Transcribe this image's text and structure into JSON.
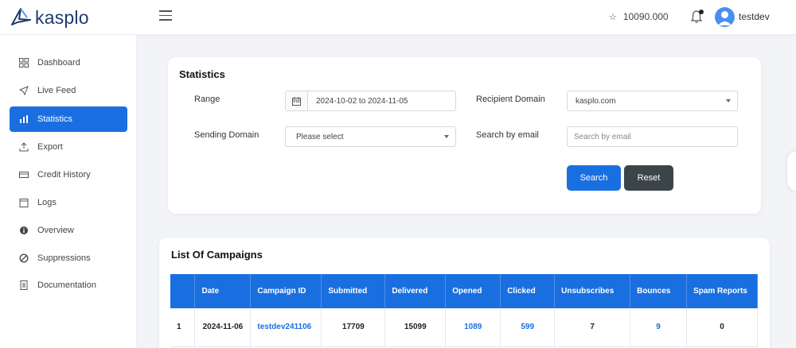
{
  "brand": {
    "name": "kasplo",
    "color": "#1d3b6e"
  },
  "header": {
    "credits": "10090.000",
    "username": "testdev"
  },
  "sidebar": {
    "items": [
      {
        "label": "Dashboard",
        "icon": "grid-icon"
      },
      {
        "label": "Live Feed",
        "icon": "send-icon"
      },
      {
        "label": "Statistics",
        "icon": "bar-chart-icon"
      },
      {
        "label": "Export",
        "icon": "upload-icon"
      },
      {
        "label": "Credit History",
        "icon": "card-icon"
      },
      {
        "label": "Logs",
        "icon": "calendar-icon"
      },
      {
        "label": "Overview",
        "icon": "info-icon"
      },
      {
        "label": "Suppressions",
        "icon": "ban-icon"
      },
      {
        "label": "Documentation",
        "icon": "document-icon"
      }
    ]
  },
  "statistics": {
    "title": "Statistics",
    "range_label": "Range",
    "range_value": "2024-10-02 to 2024-11-05",
    "recipient_domain_label": "Recipient Domain",
    "recipient_domain_value": "kasplo.com",
    "sending_domain_label": "Sending Domain",
    "sending_domain_value": "Please select",
    "search_email_label": "Search by email",
    "search_email_placeholder": "Search by email",
    "search_button": "Search",
    "reset_button": "Reset"
  },
  "campaigns": {
    "title": "List Of Campaigns",
    "columns": [
      "",
      "Date",
      "Campaign ID",
      "Submitted",
      "Delivered",
      "Opened",
      "Clicked",
      "Unsubscribes",
      "Bounces",
      "Spam Reports"
    ],
    "rows": [
      {
        "index": "1",
        "date": "2024-11-06",
        "campaign_id": "testdev241106",
        "submitted": "17709",
        "delivered": "15099",
        "opened": "1089",
        "clicked": "599",
        "unsubscribes": "7",
        "bounces": "9",
        "spam": "0"
      }
    ]
  },
  "colors": {
    "primary": "#1a6fe0",
    "reset": "#3b4449",
    "background": "#f3f4f8"
  }
}
